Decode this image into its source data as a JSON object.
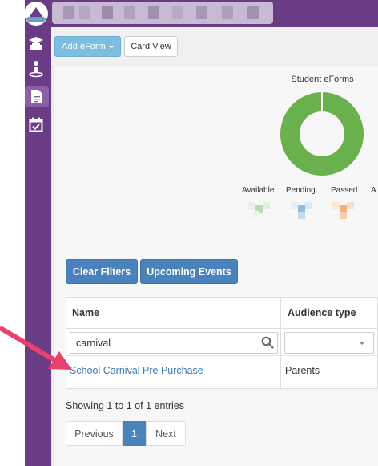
{
  "sidebar": {
    "items": [
      {
        "icon": "graduation-cap-icon"
      },
      {
        "icon": "student-icon"
      },
      {
        "icon": "document-icon",
        "active": true
      },
      {
        "icon": "calendar-check-icon"
      }
    ]
  },
  "toolbar": {
    "add_label": "Add eForm",
    "card_view_label": "Card View"
  },
  "chart": {
    "title": "Student eForms",
    "legend": [
      {
        "label": "Available",
        "color": "#b9dbb3"
      },
      {
        "label": "Pending",
        "color": "#8fbde0"
      },
      {
        "label": "Passed",
        "color": "#f0b27a"
      },
      {
        "label": "A"
      }
    ]
  },
  "chart_data": {
    "type": "pie",
    "title": "Student eForms",
    "categories": [
      "Available",
      "Pending",
      "Passed"
    ],
    "values": [
      100,
      0,
      0
    ],
    "colors": [
      "#6ab04c",
      "#4a82bb",
      "#f0a050"
    ]
  },
  "filters": {
    "clear_label": "Clear Filters",
    "upcoming_label": "Upcoming Events"
  },
  "table": {
    "columns": [
      "Name",
      "Audience type"
    ],
    "search_value": "carnival",
    "rows": [
      {
        "name": "School Carnival Pre Purchase",
        "audience": "Parents"
      }
    ],
    "info": "Showing 1 to 1 of 1 entries"
  },
  "pagination": {
    "prev_label": "Previous",
    "current_page": "1",
    "next_label": "Next"
  },
  "colors": {
    "sidebar": "#6a3c86",
    "primary_button": "#4a82bb",
    "add_button": "#7cbde0",
    "link": "#3d7ab8",
    "annotation_arrow": "#e8416e"
  }
}
